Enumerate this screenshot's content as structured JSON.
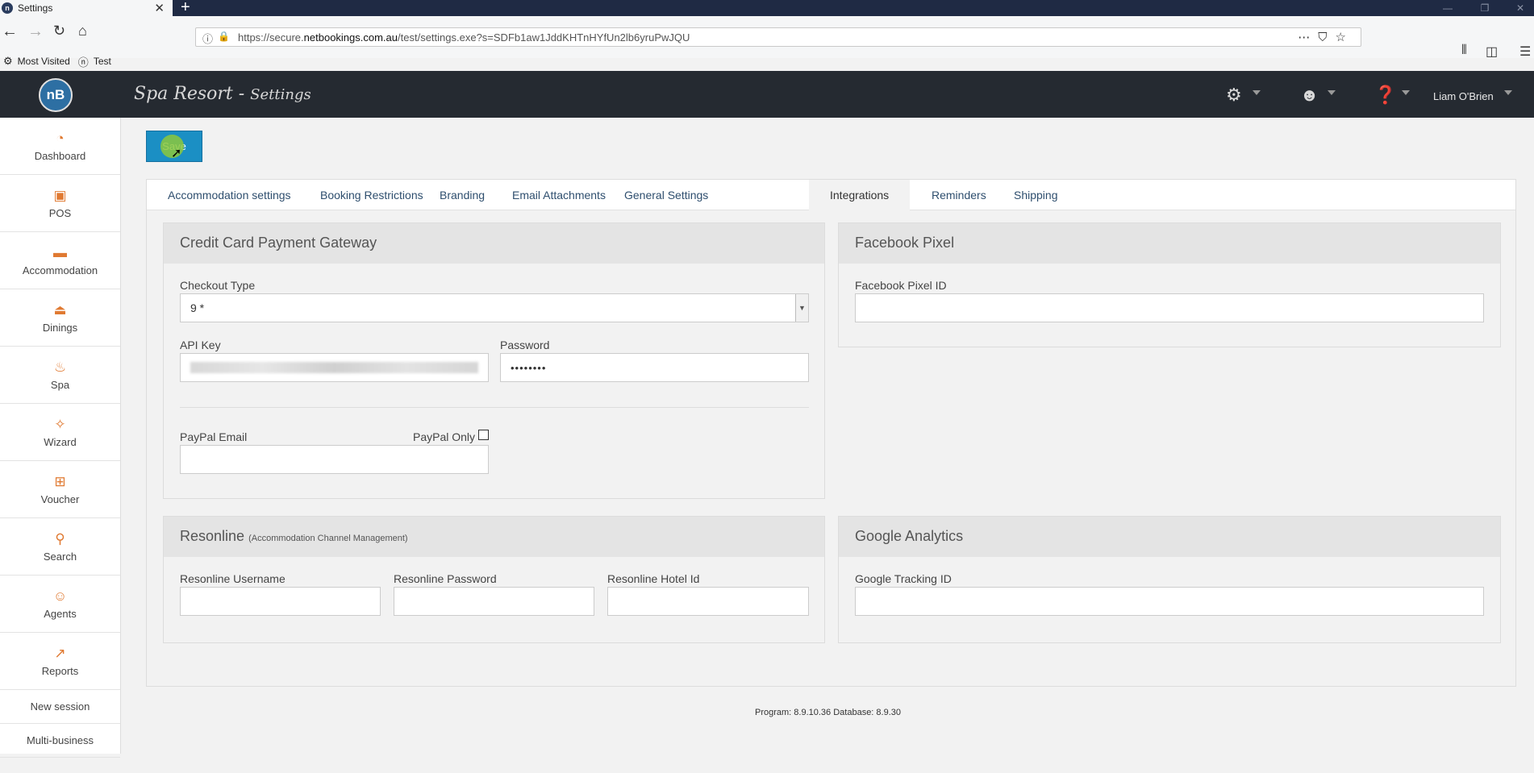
{
  "browser": {
    "tab_title": "Settings",
    "tab_favicon": "n",
    "url_prefix": "https://secure.",
    "url_domain": "netbookings.com.au",
    "url_rest": "/test/settings.exe?s=SDFb1aw1JddKHTnHYfUn2lb6yruPwJQU",
    "bookmarks": [
      "Most Visited",
      "Test"
    ]
  },
  "header": {
    "logo_text": "nB",
    "title": "Spa Resort - ",
    "subtitle": "Settings",
    "user_name": "Liam O'Brien"
  },
  "sidebar": {
    "items": [
      {
        "label": "Dashboard",
        "icon": "dashboard-icon"
      },
      {
        "label": "POS",
        "icon": "pos-icon"
      },
      {
        "label": "Accommodation",
        "icon": "bed-icon"
      },
      {
        "label": "Dinings",
        "icon": "dining-icon"
      },
      {
        "label": "Spa",
        "icon": "spa-icon"
      },
      {
        "label": "Wizard",
        "icon": "wand-icon"
      },
      {
        "label": "Voucher",
        "icon": "gift-icon"
      },
      {
        "label": "Search",
        "icon": "search-icon"
      },
      {
        "label": "Agents",
        "icon": "agent-icon"
      },
      {
        "label": "Reports",
        "icon": "chart-icon"
      }
    ],
    "links": [
      "New session",
      "Multi-business"
    ]
  },
  "toolbar": {
    "save_label": "Save"
  },
  "tabs": [
    "Accommodation settings",
    "Booking Restrictions",
    "Branding",
    "Email Attachments",
    "General Settings",
    "Integrations",
    "Reminders",
    "Shipping"
  ],
  "active_tab": "Integrations",
  "credit_card": {
    "title": "Credit Card Payment Gateway",
    "checkout_type_label": "Checkout Type",
    "checkout_type_value": "9 *",
    "api_key_label": "API Key",
    "password_label": "Password",
    "password_value": "••••••••",
    "paypal_email_label": "PayPal Email",
    "paypal_only_label": "PayPal Only"
  },
  "facebook": {
    "title": "Facebook Pixel",
    "pixel_id_label": "Facebook Pixel ID"
  },
  "resonline": {
    "title": "Resonline",
    "subtitle": "(Accommodation Channel Management)",
    "username_label": "Resonline Username",
    "password_label": "Resonline Password",
    "hotel_id_label": "Resonline Hotel Id"
  },
  "google": {
    "title": "Google Analytics",
    "tracking_label": "Google Tracking ID"
  },
  "footer": {
    "version": "Program: 8.9.10.36 Database: 8.9.30"
  }
}
